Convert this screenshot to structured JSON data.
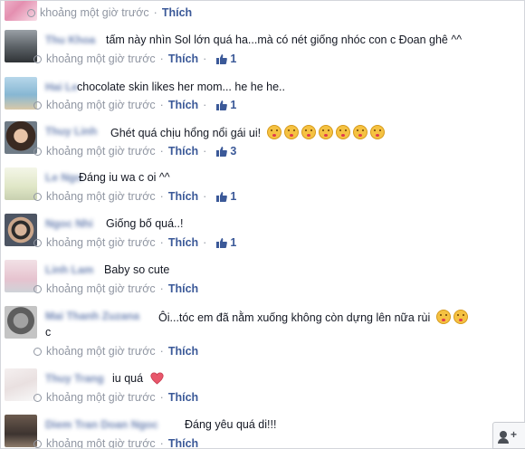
{
  "comments": [
    {
      "text": "",
      "time": "khoảng một giờ trước",
      "like_label": "Thích",
      "likes": null,
      "avatar": "avatar-pink-flowers"
    },
    {
      "text": "tấm này nhìn Sol lớn quá ha...mà có nét giống nhóc con c Đoan ghê ^^",
      "time": "khoảng một giờ trước",
      "like_label": "Thích",
      "likes": "1",
      "avatar": "avatar-car"
    },
    {
      "text": "chocolate skin likes her mom... he he he..",
      "time": "khoảng một giờ trước",
      "like_label": "Thích",
      "likes": "1",
      "avatar": "avatar-beach"
    },
    {
      "text": "Ghét quá chịu hổng nổi gái ui!",
      "time": "khoảng một giờ trước",
      "like_label": "Thích",
      "likes": "3",
      "emoji_count": 7,
      "avatar": "avatar-woman-dark-hair"
    },
    {
      "text": "Đáng iu wa c oi ^^",
      "time": "khoảng một giờ trước",
      "like_label": "Thích",
      "likes": "1",
      "avatar": "avatar-bright-window"
    },
    {
      "text": "Giống bố quá..!",
      "time": "khoảng một giờ trước",
      "like_label": "Thích",
      "likes": "1",
      "avatar": "avatar-woman-sunglasses"
    },
    {
      "text": "Baby so cute",
      "time": "khoảng một giờ trước",
      "like_label": "Thích",
      "likes": null,
      "avatar": "avatar-light-pink"
    },
    {
      "text": "Ôi...tóc em đã nằm xuống không còn dựng lên nữa rùi",
      "text2": "c",
      "time": "khoảng một giờ trước",
      "like_label": "Thích",
      "likes": null,
      "emoji_count": 2,
      "avatar": "avatar-gray-portrait"
    },
    {
      "text": "iu quá",
      "time": "khoảng một giờ trước",
      "like_label": "Thích",
      "likes": null,
      "avatar": "avatar-pale-sketch"
    },
    {
      "text": "Đáng yêu quá di!!!",
      "time": "khoảng một giờ trước",
      "like_label": "Thích",
      "likes": null,
      "avatar": "avatar-dark-photo"
    }
  ],
  "colors": {
    "link": "#3b5998",
    "meta": "#9197a3",
    "text": "#141823"
  }
}
